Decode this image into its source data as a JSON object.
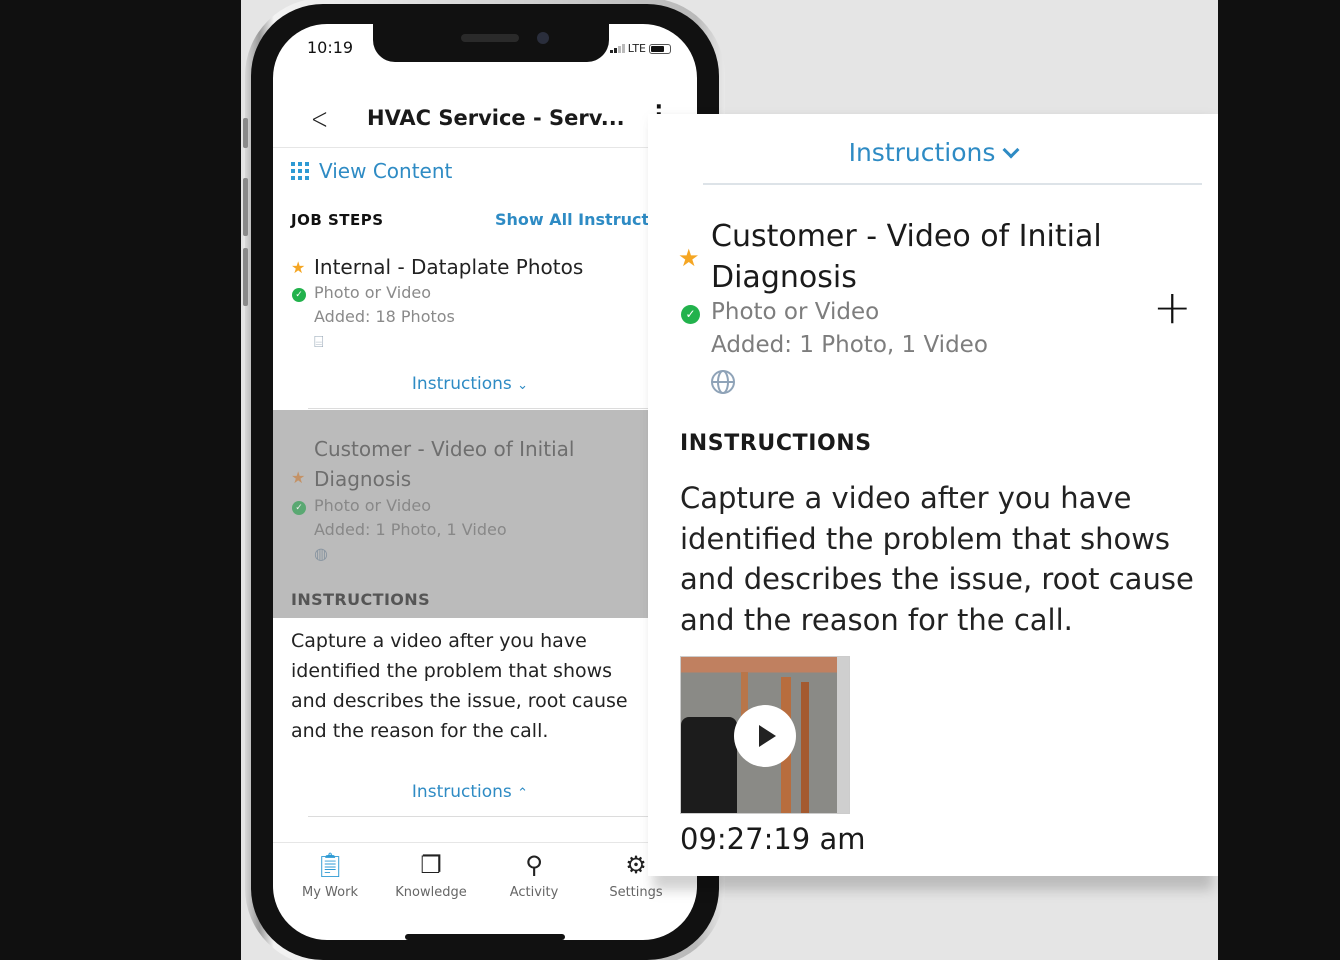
{
  "status_bar": {
    "time": "10:19",
    "network": "LTE"
  },
  "nav": {
    "title": "HVAC Service - Serv...",
    "back_icon": "chevron-left-icon",
    "more_icon": "more-vertical-icon"
  },
  "view_content": {
    "label": "View Content",
    "icon": "grid-icon"
  },
  "job_steps": {
    "heading": "JOB STEPS",
    "show_all_label": "Show All Instructi",
    "steps": [
      {
        "title": "Internal - Dataplate Photos",
        "type": "Photo or Video",
        "added": "Added: 18 Photos",
        "icon": "scan-document-icon",
        "required": true,
        "complete": true,
        "toggle_label": "Instructions",
        "toggle_state": "collapsed"
      },
      {
        "title_line1": "Customer - Video of Initial",
        "title_line2": "Diagnosis",
        "type": "Photo or Video",
        "added": "Added: 1 Photo, 1 Video",
        "icon": "globe-icon",
        "required": true,
        "complete": true,
        "instructions_heading": "INSTRUCTIONS",
        "instructions_lines": [
          "Capture a video after you have",
          "identified the problem that shows",
          "and describes the issue, root cause",
          "and the reason for the call."
        ],
        "toggle_label": "Instructions",
        "toggle_state": "expanded"
      }
    ]
  },
  "tabbar": {
    "items": [
      {
        "label": "My Work",
        "icon": "clipboard-icon",
        "active": true
      },
      {
        "label": "Knowledge",
        "icon": "book-icon",
        "active": false
      },
      {
        "label": "Activity",
        "icon": "search-icon",
        "active": false
      },
      {
        "label": "Settings",
        "icon": "gear-icon",
        "active": false
      }
    ]
  },
  "zoom_card": {
    "toggle_label": "Instructions",
    "title_line1": "Customer - Video of Initial",
    "title_line2": "Diagnosis",
    "type": "Photo or Video",
    "added": "Added: 1 Photo, 1 Video",
    "add_icon": "plus-icon",
    "instructions_heading": "INSTRUCTIONS",
    "instructions_lines": [
      "Capture a video after you have",
      "identified the problem that shows",
      "and describes the issue, root cause",
      "and the reason for the call."
    ],
    "media": {
      "kind": "video",
      "timestamp": "09:27:19 am"
    }
  },
  "colors": {
    "accent": "#2e8bc4",
    "star": "#f5a623",
    "check": "#22b24c",
    "stage_bg": "#e5e5e5",
    "outer_bg": "#101010"
  }
}
